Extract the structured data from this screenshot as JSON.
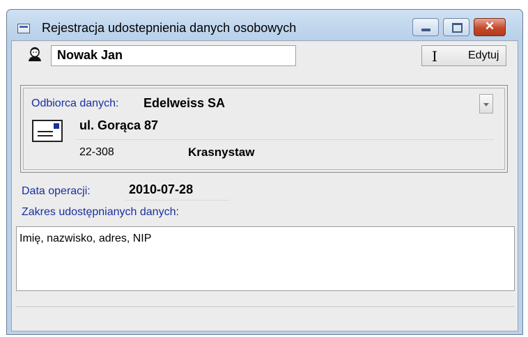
{
  "window": {
    "title": "Rejestracja udostepnienia danych osobowych",
    "close_glyph": "✕"
  },
  "header": {
    "person_name": "Nowak Jan",
    "edit_button_label": "Edytuj",
    "edit_cursor_glyph": "I"
  },
  "recipient": {
    "label": "Odbiorca danych:",
    "name": "Edelweiss SA",
    "street": "ul. Gorąca 87",
    "postal_code": "22-308",
    "city": "Krasnystaw"
  },
  "operation": {
    "date_label": "Data operacji:",
    "date": "2010-07-28",
    "scope_label": "Zakres udostępnianych danych:",
    "scope_text": "Imię, nazwisko, adres, NIP"
  },
  "icons": {
    "app": "app-window-icon",
    "person": "person-icon",
    "envelope": "envelope-icon",
    "dropdown": "chevron-down-icon"
  }
}
